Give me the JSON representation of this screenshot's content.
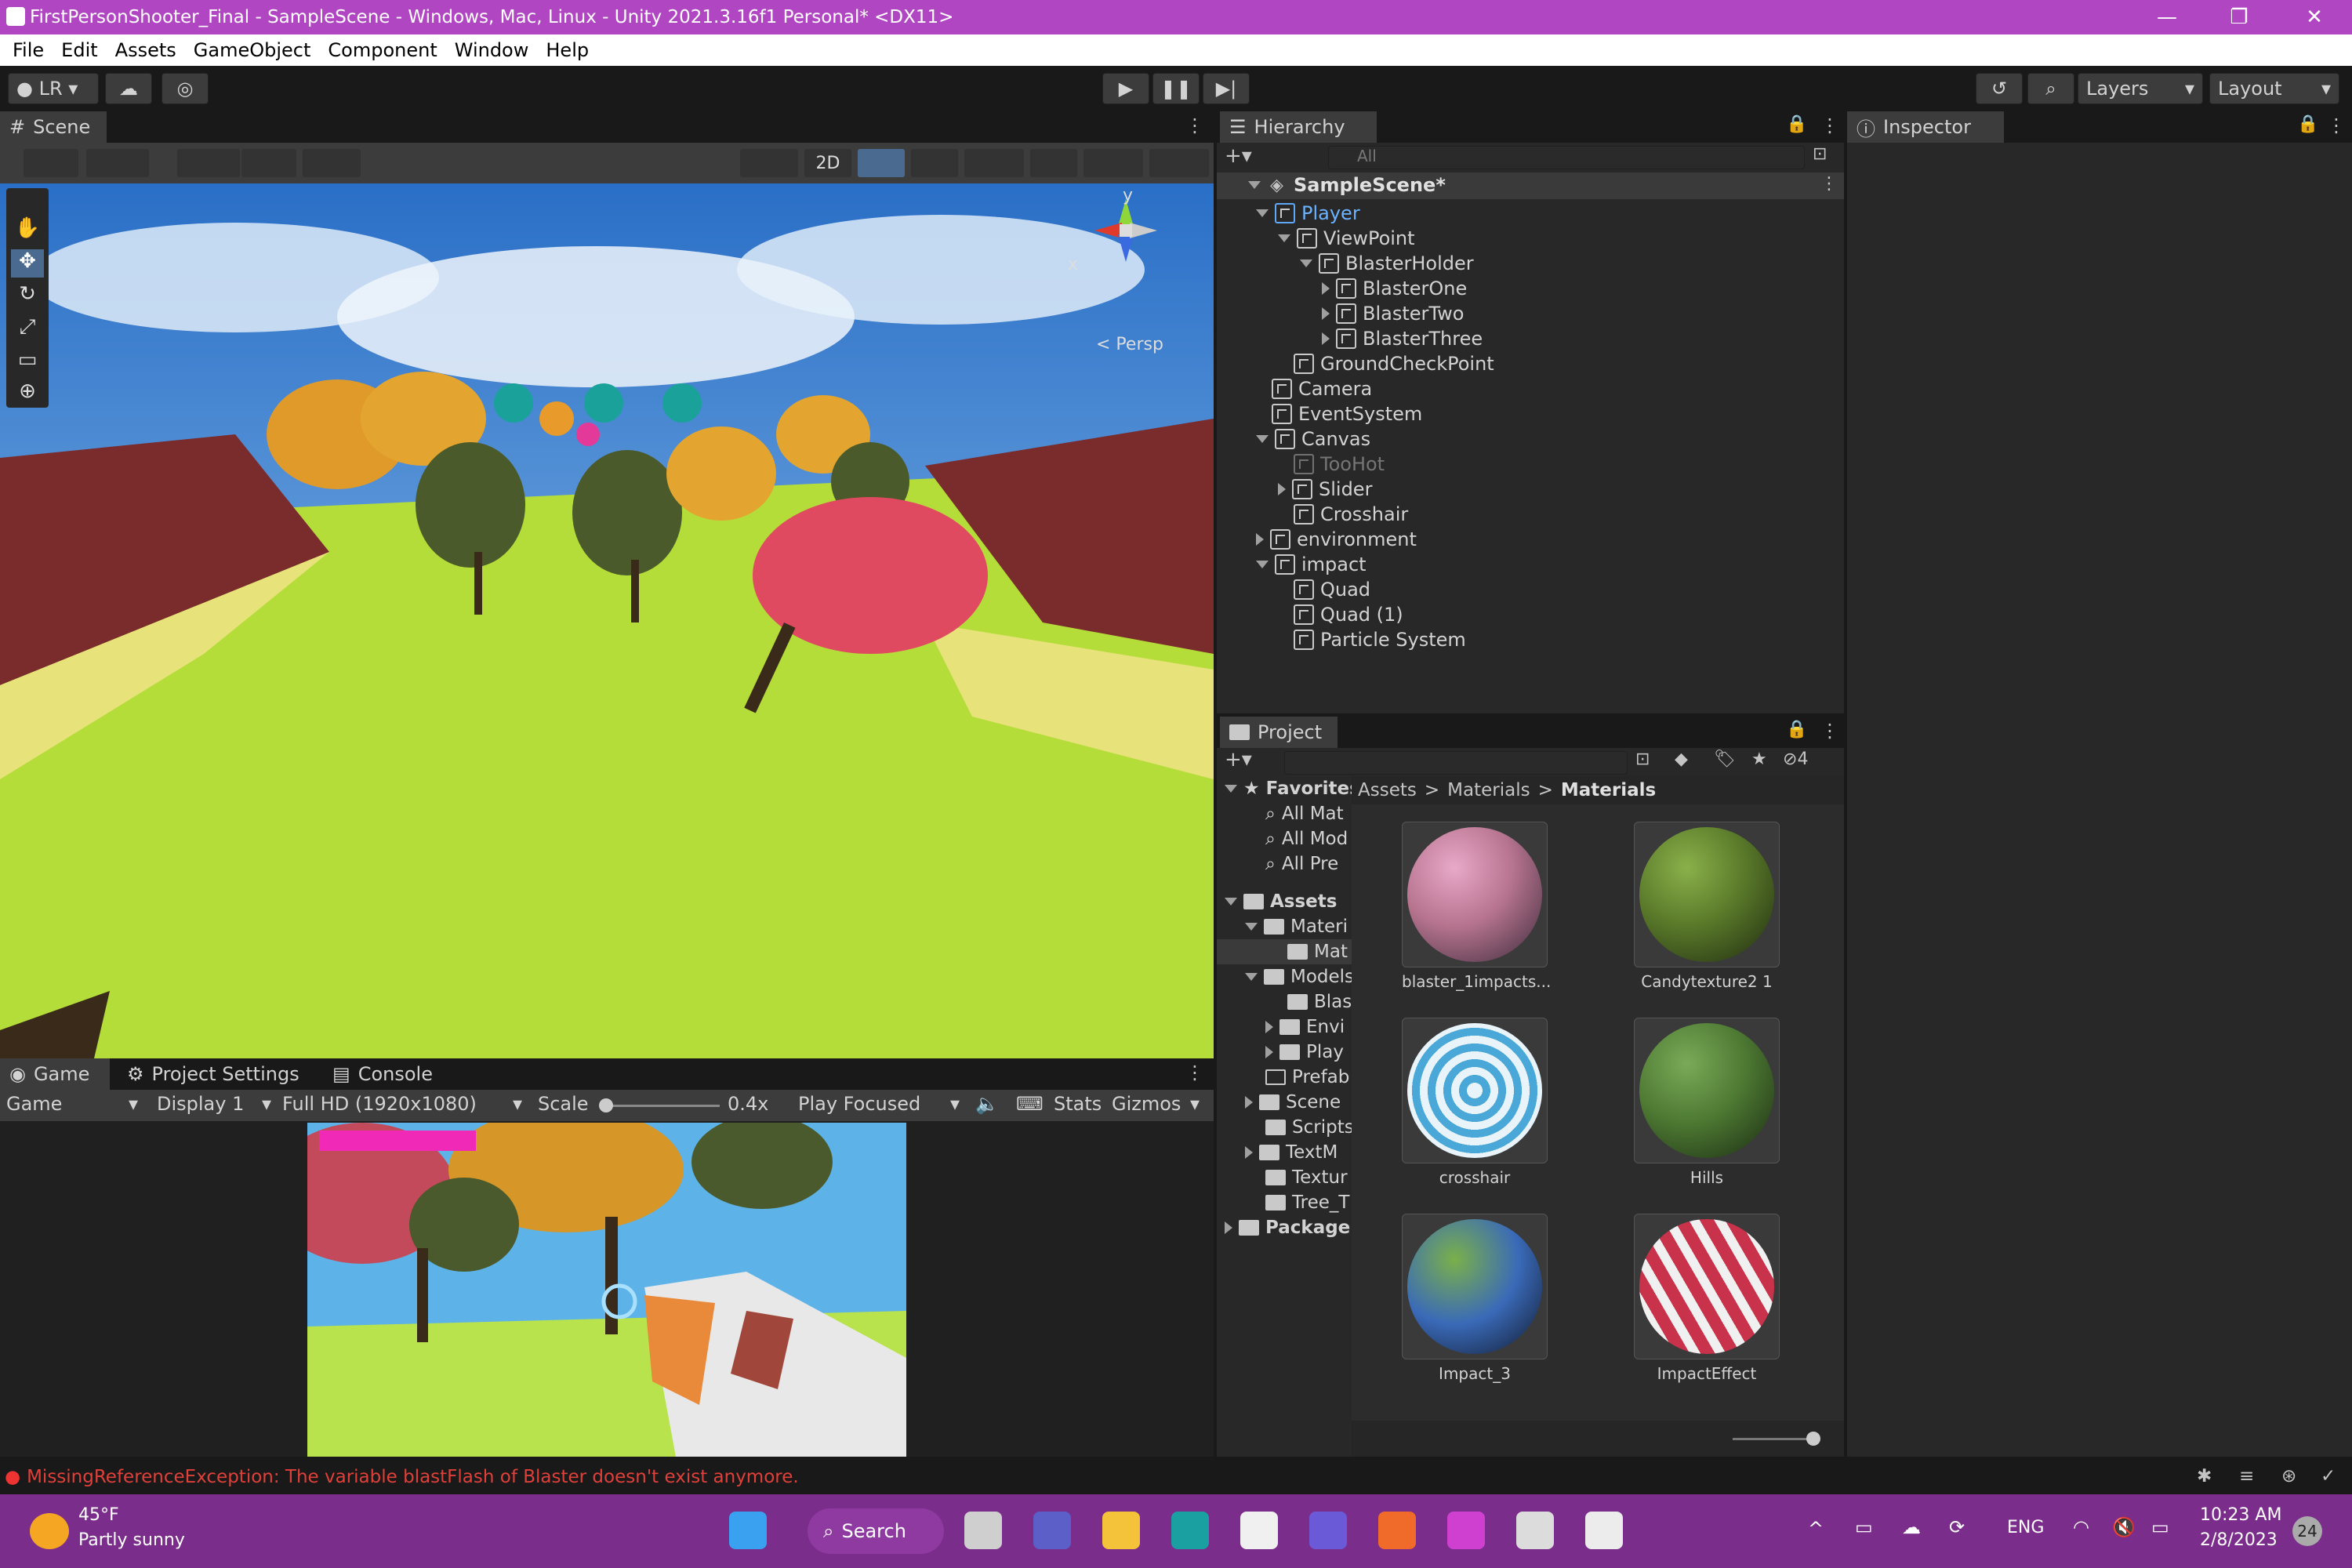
{
  "window": {
    "title": "FirstPersonShooter_Final - SampleScene - Windows, Mac, Linux - Unity 2021.3.16f1 Personal* <DX11>"
  },
  "menu": [
    "File",
    "Edit",
    "Assets",
    "GameObject",
    "Component",
    "Window",
    "Help"
  ],
  "toolbar": {
    "account": "LR",
    "layers": "Layers",
    "layout": "Layout"
  },
  "scene": {
    "tab": "Scene",
    "btn_2d": "2D",
    "persp": "< Persp",
    "gizmo_y": "y",
    "gizmo_x": "x"
  },
  "hierarchy": {
    "tab": "Hierarchy",
    "search_placeholder": "All",
    "scene_name": "SampleScene*",
    "items": [
      "Player",
      "ViewPoint",
      "BlasterHolder",
      "BlasterOne",
      "BlasterTwo",
      "BlasterThree",
      "GroundCheckPoint",
      "Camera",
      "EventSystem",
      "Canvas",
      "TooHot",
      "Slider",
      "Crosshair",
      "environment",
      "impact",
      "Quad",
      "Quad (1)",
      "Particle System"
    ]
  },
  "inspector": {
    "tab": "Inspector"
  },
  "project": {
    "tab": "Project",
    "hidden_count": "4",
    "breadcrumb": [
      "Assets",
      "Materials",
      "Materials"
    ],
    "tree": [
      "Favorites",
      "All Mat",
      "All Mod",
      "All Pre",
      "Assets",
      "Materi",
      "Mat",
      "Models",
      "Blas",
      "Envi",
      "Play",
      "Prefab",
      "Scene",
      "Scripts",
      "TextM",
      "Textur",
      "Tree_T",
      "Package"
    ],
    "materials": [
      {
        "name": "blaster_1impacts...",
        "color": "#b7748f"
      },
      {
        "name": "Candytexture2 1",
        "color": "#5a7a2a"
      },
      {
        "name": "crosshair",
        "color": "#4aa8d8"
      },
      {
        "name": "Hills",
        "color": "#4e7a33"
      },
      {
        "name": "Impact_3",
        "color": "#3a6ab8"
      },
      {
        "name": "ImpactEffect",
        "color": "#c8324a"
      }
    ]
  },
  "game": {
    "tabs": [
      "Game",
      "Project Settings",
      "Console"
    ],
    "display_mode": "Game",
    "display": "Display 1",
    "resolution": "Full HD (1920x1080)",
    "scale_label": "Scale",
    "scale_value": "0.4x",
    "play_mode": "Play Focused",
    "stats": "Stats",
    "gizmos": "Gizmos"
  },
  "status": {
    "error": "MissingReferenceException: The variable blastFlash of Blaster doesn't exist anymore."
  },
  "taskbar": {
    "temp": "45°F",
    "weather": "Partly sunny",
    "search": "Search",
    "lang": "ENG",
    "time": "10:23 AM",
    "date": "2/8/2023",
    "badge": "24"
  }
}
